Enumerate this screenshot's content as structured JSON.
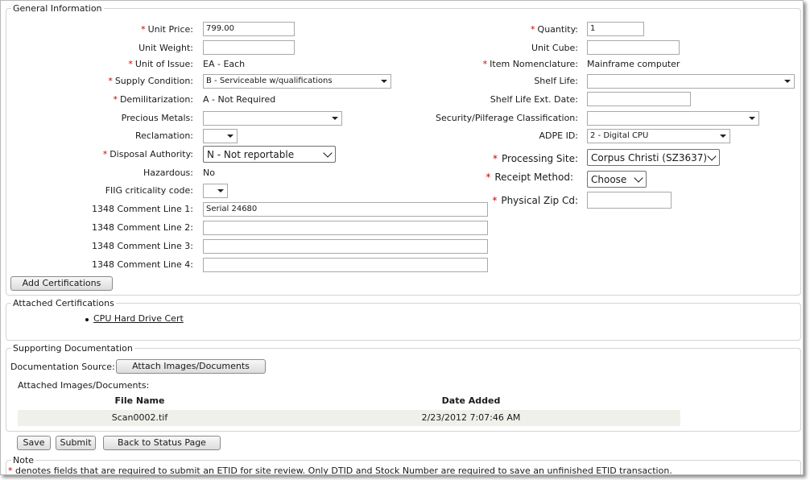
{
  "sections": {
    "general": "General Information",
    "attached": "Attached Certifications",
    "supporting": "Supporting Documentation",
    "note": "Note"
  },
  "left": {
    "unit_price": {
      "label": "Unit Price:",
      "value": "799.00"
    },
    "unit_weight": {
      "label": "Unit Weight:",
      "value": ""
    },
    "unit_of_issue": {
      "label": "Unit of Issue:",
      "value": "EA - Each"
    },
    "supply_condition": {
      "label": "Supply Condition:",
      "value": "B - Serviceable w/qualifications"
    },
    "demil": {
      "label": "Demilitarization:",
      "value": "A - Not Required"
    },
    "precious_metals": {
      "label": "Precious Metals:",
      "value": ""
    },
    "reclamation": {
      "label": "Reclamation:",
      "value": ""
    },
    "disposal_authority": {
      "label": "Disposal Authority:",
      "value": "N - Not reportable"
    },
    "hazardous": {
      "label": "Hazardous:",
      "value": "No"
    },
    "fiig": {
      "label": "FIIG criticality code:",
      "value": ""
    },
    "comment1": {
      "label": "1348 Comment Line 1:",
      "value": "Serial 24680"
    },
    "comment2": {
      "label": "1348 Comment Line 2:",
      "value": ""
    },
    "comment3": {
      "label": "1348 Comment Line 3:",
      "value": ""
    },
    "comment4": {
      "label": "1348 Comment Line 4:",
      "value": ""
    }
  },
  "right": {
    "quantity": {
      "label": "Quantity:",
      "value": "1"
    },
    "unit_cube": {
      "label": "Unit Cube:",
      "value": ""
    },
    "item_nomenclature": {
      "label": "Item Nomenclature:",
      "value": "Mainframe computer"
    },
    "shelf_life": {
      "label": "Shelf Life:",
      "value": ""
    },
    "shelf_life_ext": {
      "label": "Shelf Life Ext. Date:",
      "value": ""
    },
    "security": {
      "label": "Security/Pilferage Classification:",
      "value": ""
    },
    "adpe_id": {
      "label": "ADPE ID:",
      "value": "2 - Digital CPU"
    },
    "processing_site": {
      "label": "Processing Site:",
      "value": "Corpus Christi (SZ3637)"
    },
    "receipt_method": {
      "label": "Receipt Method:",
      "value": "Choose"
    },
    "zip": {
      "label": "Physical Zip Cd:",
      "value": ""
    }
  },
  "buttons": {
    "add_certifications": "Add Certifications",
    "attach": "Attach Images/Documents",
    "save": "Save",
    "submit": "Submit",
    "back": "Back to Status Page"
  },
  "certifications": [
    "CPU Hard Drive Cert"
  ],
  "documents": {
    "source_label": "Documentation Source:",
    "attached_label": "Attached Images/Documents:",
    "col_file": "File Name",
    "col_date": "Date Added",
    "rows": [
      {
        "file": "Scan0002.tif",
        "date": "2/23/2012 7:07:46 AM"
      }
    ]
  },
  "required_mark": "*",
  "note_text": "denotes fields that are required to submit an ETID for site review. Only DTID and Stock Number are required to save an unfinished ETID transaction.",
  "colors": {
    "required": "#cc0000",
    "row_bg": "#f0f0ea"
  }
}
